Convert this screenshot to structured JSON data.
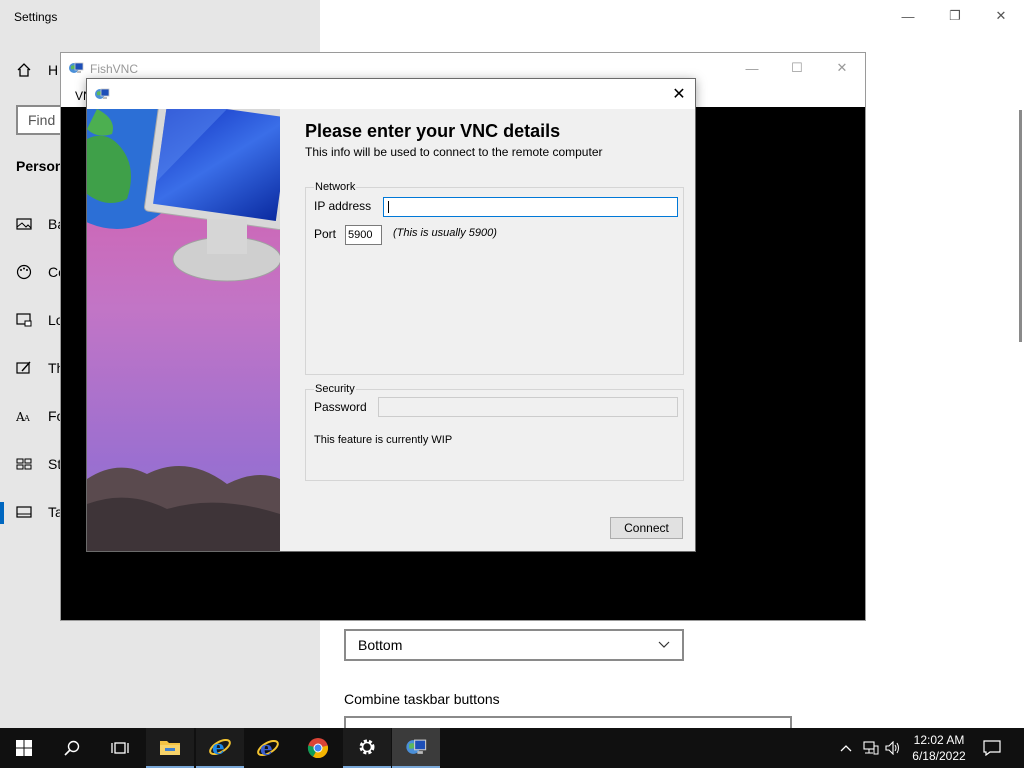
{
  "settings": {
    "app_title": "Settings",
    "home_label": "H",
    "find_placeholder": "Find",
    "section_label": "Person",
    "nav_items": [
      "Ba",
      "Co",
      "Lo",
      "Th",
      "Fo",
      "St",
      "Ta"
    ],
    "position_value": "Bottom",
    "combine_label": "Combine taskbar buttons",
    "caption_minimize": "—",
    "caption_restore": "❐",
    "caption_close": "✕"
  },
  "fishvnc": {
    "title": "FishVNC",
    "menu_vnc": "VN",
    "caption_minimize": "—",
    "caption_maximize": "☐",
    "caption_close": "✕"
  },
  "dialog": {
    "close": "✕",
    "heading": "Please enter your VNC details",
    "subheading": "This info will be used to connect to the remote computer",
    "network": {
      "group_title": "Network",
      "ip_label": "IP address",
      "ip_value": "",
      "port_label": "Port",
      "port_value": "5900",
      "port_hint": "(This is usually 5900)"
    },
    "security": {
      "group_title": "Security",
      "password_label": "Password",
      "wip_note": "This feature is currently WIP"
    },
    "connect_label": "Connect"
  },
  "taskbar": {
    "time": "12:02 AM",
    "date": "6/18/2022",
    "icons": [
      "start-icon",
      "search-icon",
      "task-view-icon",
      "file-explorer-icon",
      "ie-icon",
      "edge-legacy-icon",
      "chrome-icon",
      "settings-icon",
      "fishvnc-icon"
    ]
  },
  "colors": {
    "accent": "#0078d7",
    "taskbar_bg": "#101010",
    "dialog_bg": "#f0f0f0",
    "vnc_canvas": "#000000"
  }
}
